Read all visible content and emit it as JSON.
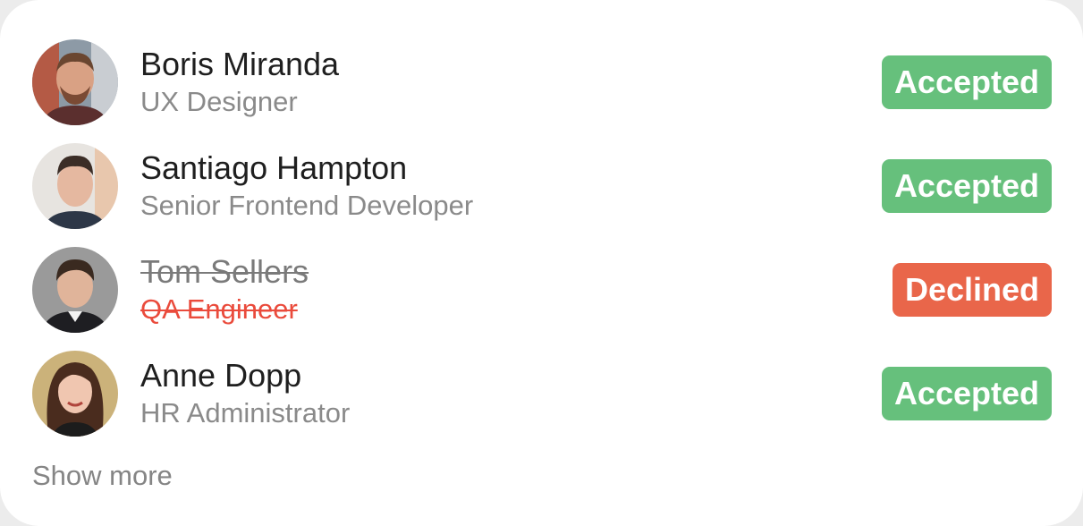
{
  "people": [
    {
      "name": "Boris Miranda",
      "role": "UX Designer",
      "status": "Accepted",
      "state": "accepted"
    },
    {
      "name": "Santiago Hampton",
      "role": "Senior Frontend Developer",
      "status": "Accepted",
      "state": "accepted"
    },
    {
      "name": "Tom Sellers",
      "role": "QA Engineer",
      "status": "Declined",
      "state": "declined"
    },
    {
      "name": "Anne Dopp",
      "role": "HR Administrator",
      "status": "Accepted",
      "state": "accepted"
    }
  ],
  "show_more_label": "Show more",
  "colors": {
    "accepted": "#66c07c",
    "declined": "#e9664a",
    "declined_role": "#ea4b3c"
  }
}
